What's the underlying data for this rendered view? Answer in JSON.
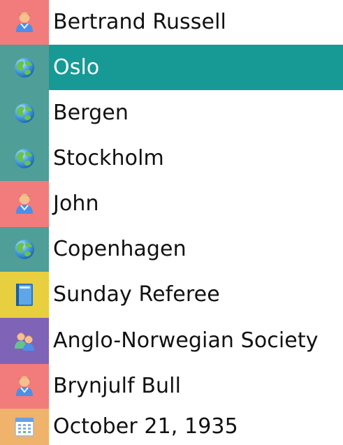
{
  "items": [
    {
      "label": "Bertrand Russell",
      "type": "person",
      "icon": "person-icon",
      "color": "#f27b7b",
      "selected": false
    },
    {
      "label": "Oslo",
      "type": "place",
      "icon": "globe-icon",
      "color": "#4f9e98",
      "selected": true
    },
    {
      "label": "Bergen",
      "type": "place",
      "icon": "globe-icon",
      "color": "#4f9e98",
      "selected": false
    },
    {
      "label": "Stockholm",
      "type": "place",
      "icon": "globe-icon",
      "color": "#4f9e98",
      "selected": false
    },
    {
      "label": "John",
      "type": "person",
      "icon": "person-icon",
      "color": "#f27b7b",
      "selected": false
    },
    {
      "label": "Copenhagen",
      "type": "place",
      "icon": "globe-icon",
      "color": "#4f9e98",
      "selected": false
    },
    {
      "label": "Sunday Referee",
      "type": "publication",
      "icon": "book-icon",
      "color": "#e8cf3f",
      "selected": false
    },
    {
      "label": "Anglo-Norwegian Society",
      "type": "organization",
      "icon": "group-icon",
      "color": "#7f63b7",
      "selected": false
    },
    {
      "label": "Brynjulf Bull",
      "type": "person",
      "icon": "person-icon",
      "color": "#f27b7b",
      "selected": false
    },
    {
      "label": "October 21, 1935",
      "type": "date",
      "icon": "calendar-icon",
      "color": "#f0b36b",
      "selected": false
    }
  ],
  "colors": {
    "selected_row": "#179a96",
    "text": "#111111",
    "selected_text": "#ffffff"
  }
}
